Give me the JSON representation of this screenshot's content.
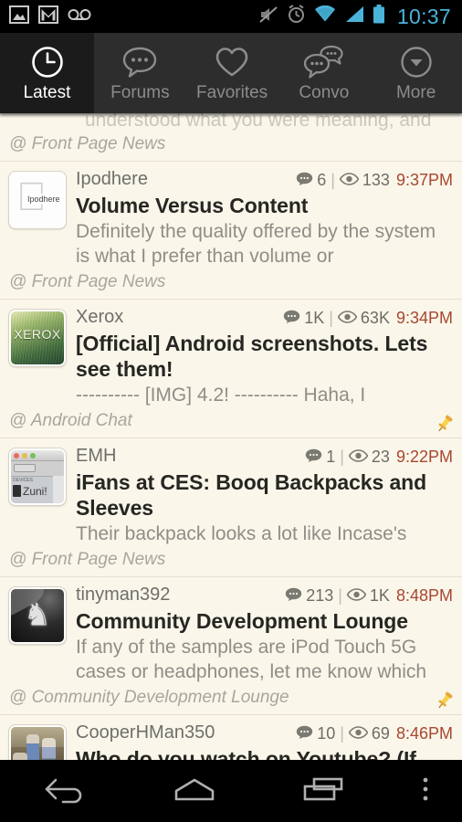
{
  "statusbar": {
    "time": "10:37",
    "left_icons": [
      "image-icon",
      "gmail-icon",
      "voicemail-icon"
    ],
    "right_icons": [
      "mute-icon",
      "alarm-icon",
      "wifi-icon",
      "signal-icon",
      "battery-icon"
    ],
    "time_color": "#4ab3d8"
  },
  "tabs": [
    {
      "label": "Latest",
      "icon": "clock-icon",
      "active": true
    },
    {
      "label": "Forums",
      "icon": "speech-bubble-icon",
      "active": false
    },
    {
      "label": "Favorites",
      "icon": "heart-icon",
      "active": false
    },
    {
      "label": "Convo",
      "icon": "double-speech-bubble-icon",
      "active": false
    },
    {
      "label": "More",
      "icon": "chevron-down-circle-icon",
      "active": false
    }
  ],
  "colors": {
    "background": "#faf6ea",
    "tabbar": "#2d2d2d",
    "tab_active_bg": "#1b1b1b",
    "timestamp": "#a8472f",
    "title": "#262622",
    "snippet": "#8e8e87",
    "forum": "#a9a69b",
    "pin": "#f2c230"
  },
  "posts": [
    {
      "partial": true,
      "snippet_tail": "understood what you were meaning, and",
      "forum": "@ Front Page News",
      "pinned": false
    },
    {
      "author": "Ipodhere",
      "avatar": "apple-logo-avatar",
      "replies": "6",
      "views": "133",
      "time": "9:37PM",
      "title": "Volume Versus Content",
      "snippet": "Definitely the quality offered by the system is what I prefer than volume or",
      "forum": "@ Front Page News",
      "pinned": false
    },
    {
      "author": "Xerox",
      "avatar": "xerox-green-avatar",
      "avatar_text": "XEROX",
      "replies": "1K",
      "views": "63K",
      "time": "9:34PM",
      "title": "[Official] Android screenshots. Lets see them!",
      "snippet": "---------- [IMG] 4.2! ----------   Haha, I",
      "forum": "@ Android Chat",
      "pinned": true
    },
    {
      "author": "EMH",
      "avatar": "mac-window-avatar",
      "avatar_text": "Zuni!",
      "replies": "1",
      "views": "23",
      "time": "9:22PM",
      "title": "iFans at CES: Booq Backpacks and Sleeves",
      "snippet": "Their backpack looks a lot like Incase's",
      "forum": "@ Front Page News",
      "pinned": false
    },
    {
      "author": "tinyman392",
      "avatar": "prancing-horse-avatar",
      "replies": "213",
      "views": "1K",
      "time": "8:48PM",
      "title": "Community Development Lounge",
      "snippet": "If any of the samples are iPod Touch 5G cases or headphones, let me know which",
      "forum": "@ Community Development Lounge",
      "pinned": true
    },
    {
      "author": "CooperHMan350",
      "avatar": "photo-avatar",
      "replies": "10",
      "views": "69",
      "time": "8:46PM",
      "title": "Who do you watch on Youtube? (If",
      "snippet": "",
      "forum": "",
      "pinned": false
    }
  ],
  "navbar": [
    {
      "label": "Back",
      "icon": "back-arrow-icon"
    },
    {
      "label": "Home",
      "icon": "home-icon"
    },
    {
      "label": "Recents",
      "icon": "recents-icon"
    },
    {
      "label": "Menu",
      "icon": "overflow-menu-icon"
    }
  ]
}
